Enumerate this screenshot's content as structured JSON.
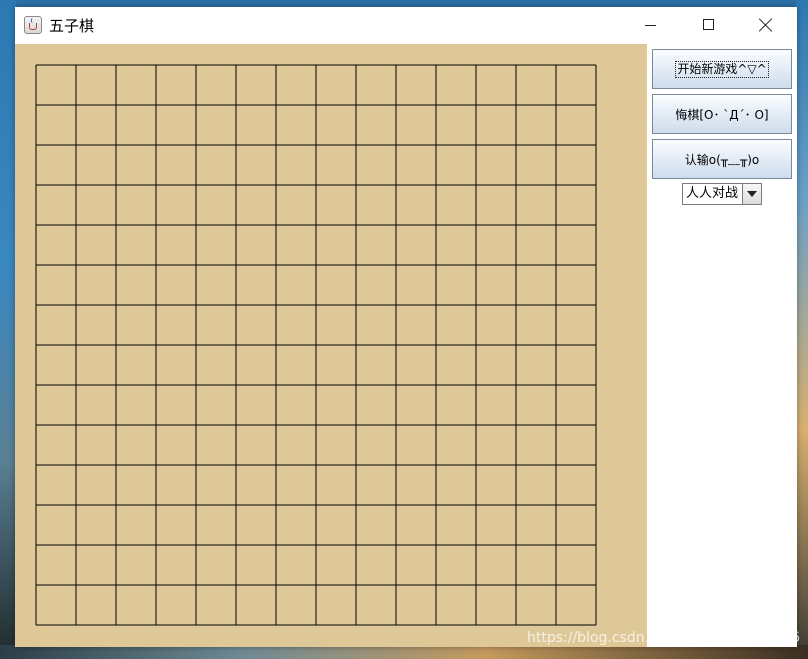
{
  "window": {
    "title": "五子棋",
    "icon": "java-coffee-icon",
    "controls": [
      "minimize-icon",
      "maximize-icon",
      "close-icon"
    ]
  },
  "board": {
    "rows": 14,
    "cols": 14,
    "background_color": "#dec898",
    "line_color": "#000000"
  },
  "side_panel": {
    "new_game_label": "开始新游戏^▽^",
    "undo_label": "悔棋[O･ `Д´･ O]",
    "surrender_label": "认输o(╥﹏╥)o",
    "mode_select": {
      "selected": "人人对战"
    }
  },
  "watermark": "https://blog.csdn.net/weixin_51937686"
}
